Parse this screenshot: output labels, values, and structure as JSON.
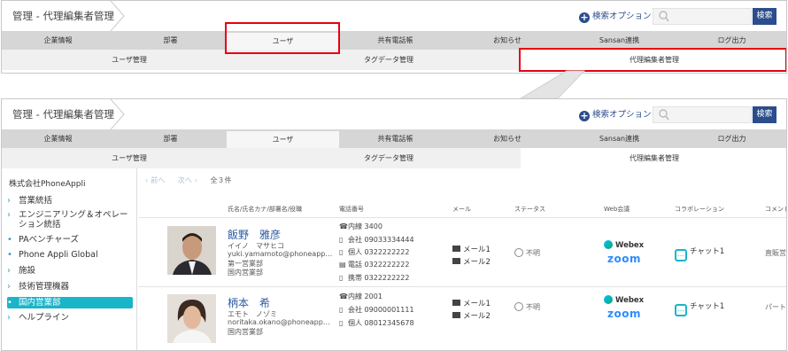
{
  "header": {
    "breadcrumb": "管理 - 代理編集者管理",
    "search_option": "検索オプション",
    "search_placeholder": "",
    "search_button": "検索"
  },
  "nav": {
    "items": [
      "企業情報",
      "部署",
      "ユーザ",
      "共有電話帳",
      "お知らせ",
      "Sansan連携",
      "ログ出力"
    ],
    "active": "ユーザ"
  },
  "subnav": {
    "items": [
      "ユーザ管理",
      "タグデータ管理",
      "代理編集者管理"
    ],
    "active": "代理編集者管理"
  },
  "sidebar": {
    "company": "株式会社PhoneAppli",
    "items": [
      {
        "label": "営業統括",
        "marker": "›"
      },
      {
        "label": "エンジニアリング＆オペレーション統括",
        "marker": "›"
      },
      {
        "label": "PAベンチャーズ",
        "marker": "•"
      },
      {
        "label": "Phone Appli Global",
        "marker": "•"
      },
      {
        "label": "施設",
        "marker": "›"
      },
      {
        "label": "技術管理機器",
        "marker": "›"
      },
      {
        "label": "国内営業部",
        "marker": "•",
        "selected": true
      },
      {
        "label": "ヘルプライン",
        "marker": "›"
      }
    ]
  },
  "pager": {
    "prev": "前へ",
    "next": "次へ",
    "count": "全３件"
  },
  "table": {
    "headers": [
      "氏名/氏名カナ/部署名/役職",
      "電話番号",
      "メール",
      "ステータス",
      "Web会議",
      "コラボレーション",
      "コメント"
    ],
    "rows": [
      {
        "name": "飯野　雅彦",
        "kana": "イイノ　マサヒコ",
        "email": "yuki.yamamoto@phoneapp…",
        "dept1": "第一営業部",
        "dept2": "国内営業部",
        "phones": [
          {
            "icon": "phone-icon",
            "label": "内線",
            "value": "3400"
          },
          {
            "icon": "mobile-icon",
            "label": "会社",
            "value": "09033334444"
          },
          {
            "icon": "mobile-icon",
            "label": "個人",
            "value": "0322222222"
          },
          {
            "icon": "fax-icon",
            "label": "電話",
            "value": "0322222222"
          },
          {
            "icon": "mobile-icon",
            "label": "携帯",
            "value": "0322222222"
          }
        ],
        "mails": [
          "メール1",
          "メール2"
        ],
        "status": "不明",
        "webex": "Webex",
        "zoom": "zoom",
        "chat": "チャット1",
        "comment": "直販営"
      },
      {
        "name": "柄本　希",
        "kana": "エモト　ノゾミ",
        "email": "noritaka.okano@phoneapp…",
        "dept1": "国内営業部",
        "dept2": "",
        "phones": [
          {
            "icon": "phone-icon",
            "label": "内線",
            "value": "2001"
          },
          {
            "icon": "mobile-icon",
            "label": "会社",
            "value": "09000001111"
          },
          {
            "icon": "mobile-icon",
            "label": "個人",
            "value": "08012345678"
          }
        ],
        "mails": [
          "メール1",
          "メール2"
        ],
        "status": "不明",
        "webex": "Webex",
        "zoom": "zoom",
        "chat": "チャット1",
        "comment": "パート"
      }
    ]
  },
  "colors": {
    "accent": "#2b4d8c",
    "highlight": "#e60012",
    "selected": "#1ab5c9"
  }
}
